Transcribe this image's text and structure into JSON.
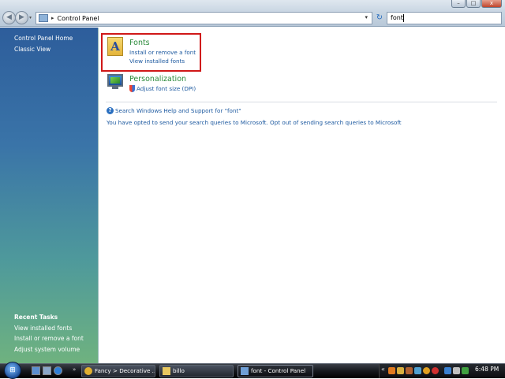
{
  "window": {
    "buttons": {
      "minimize": "–",
      "maximize": "□",
      "close": "x"
    }
  },
  "address_bar": {
    "separator": "▸",
    "breadcrumb": "Control Panel",
    "dropdown_glyph": "▾",
    "refresh_glyph": "↻"
  },
  "search": {
    "value": "font"
  },
  "nav": {
    "back_glyph": "◀",
    "forward_glyph": "▶",
    "history_glyph": "▾"
  },
  "left_pane": {
    "links": [
      "Control Panel Home",
      "Classic View"
    ],
    "recent_tasks_heading": "Recent Tasks",
    "recent_tasks": [
      "View installed fonts",
      "Install or remove a font",
      "Adjust system volume"
    ]
  },
  "results": [
    {
      "icon": "fonts-folder-icon",
      "icon_glyph": "A",
      "title": "Fonts",
      "tasks": [
        "Install or remove a font",
        "View installed fonts"
      ],
      "highlighted": true
    },
    {
      "icon": "monitor-icon",
      "title": "Personalization",
      "tasks": [
        "Adjust font size (DPI)"
      ],
      "task_has_shield": true
    }
  ],
  "help": {
    "icon_glyph": "?",
    "search_link": "Search Windows Help and Support for \"font\"",
    "optin_link": "You have opted to send your search queries to Microsoft. Opt out of sending search queries to Microsoft"
  },
  "taskbar": {
    "start_glyph": "⊞",
    "quicklaunch_more_glyph": "»",
    "tasks": [
      {
        "label": "Fancy > Decorative ...",
        "icon": "chrome-icon",
        "active": false
      },
      {
        "label": "billo",
        "icon": "folder-icon",
        "active": false
      },
      {
        "label": "font - Control Panel",
        "icon": "control-panel-icon",
        "active": true
      }
    ],
    "tray_expand_glyph": "«",
    "clock": "6:48 PM"
  },
  "colors": {
    "highlight_border": "#d01818",
    "link": "#1e5aa0",
    "category_title": "#2a8a3a",
    "left_pane_top": "#2d5d9b",
    "left_pane_bottom": "#6fb27f"
  }
}
